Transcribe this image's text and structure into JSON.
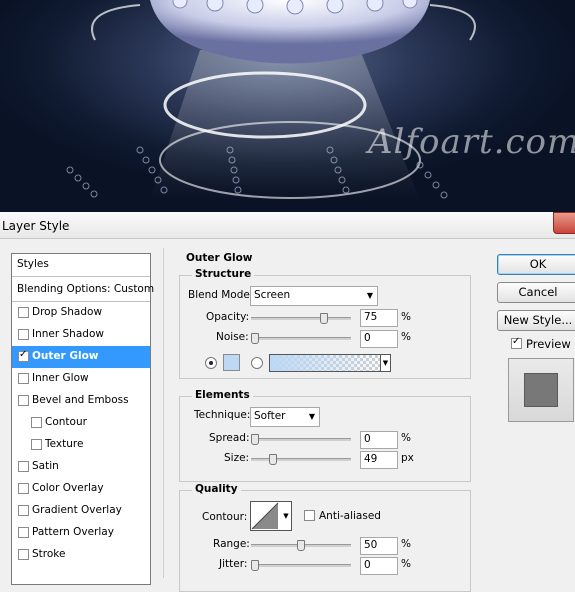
{
  "artwork": {
    "watermark": "Alfoart.com"
  },
  "dialog": {
    "title": "Layer Style",
    "style_list": {
      "header": "Styles",
      "blending": "Blending Options: Custom",
      "items": [
        {
          "label": "Drop Shadow",
          "checked": false
        },
        {
          "label": "Inner Shadow",
          "checked": false
        },
        {
          "label": "Outer Glow",
          "checked": true
        },
        {
          "label": "Inner Glow",
          "checked": false
        },
        {
          "label": "Bevel and Emboss",
          "checked": false
        },
        {
          "label": "Contour",
          "checked": false
        },
        {
          "label": "Texture",
          "checked": false
        },
        {
          "label": "Satin",
          "checked": false
        },
        {
          "label": "Color Overlay",
          "checked": false
        },
        {
          "label": "Gradient Overlay",
          "checked": false
        },
        {
          "label": "Pattern Overlay",
          "checked": false
        },
        {
          "label": "Stroke",
          "checked": false
        }
      ]
    },
    "outer_glow": {
      "title": "Outer Glow",
      "structure": {
        "title": "Structure",
        "blend_mode_label": "Blend Mode:",
        "blend_mode": "Screen",
        "opacity_label": "Opacity:",
        "opacity": "75",
        "opacity_unit": "%",
        "opacity_fraction": 0.75,
        "noise_label": "Noise:",
        "noise": "0",
        "noise_unit": "%",
        "noise_fraction": 0,
        "glow_color": "#bcd8f4"
      },
      "elements": {
        "title": "Elements",
        "technique_label": "Technique:",
        "technique": "Softer",
        "spread_label": "Spread:",
        "spread": "0",
        "spread_unit": "%",
        "spread_fraction": 0,
        "size_label": "Size:",
        "size": "49",
        "size_unit": "px",
        "size_fraction": 0.2
      },
      "quality": {
        "title": "Quality",
        "contour_label": "Contour:",
        "anti_aliased_label": "Anti-aliased",
        "anti_aliased": false,
        "range_label": "Range:",
        "range": "50",
        "range_unit": "%",
        "range_fraction": 0.5,
        "jitter_label": "Jitter:",
        "jitter": "0",
        "jitter_unit": "%",
        "jitter_fraction": 0
      }
    },
    "buttons": {
      "ok": "OK",
      "cancel": "Cancel",
      "new_style": "New Style...",
      "preview_label": "Preview",
      "preview_checked": true
    }
  }
}
